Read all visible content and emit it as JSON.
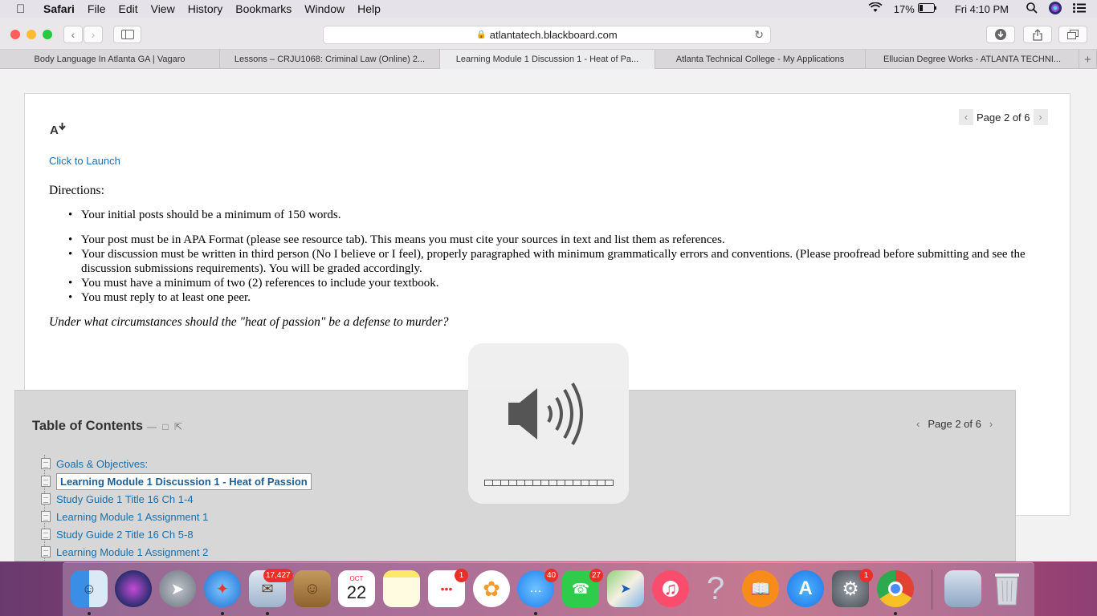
{
  "menubar": {
    "app_name": "Safari",
    "menus": [
      "File",
      "Edit",
      "View",
      "History",
      "Bookmarks",
      "Window",
      "Help"
    ],
    "battery": "17%",
    "clock": "Fri 4:10 PM"
  },
  "toolbar": {
    "url": "atlantatech.blackboard.com"
  },
  "tabs": [
    {
      "title": "Body Language In Atlanta GA | Vagaro",
      "active": false
    },
    {
      "title": "Lessons – CRJU1068: Criminal Law (Online) 2...",
      "active": false
    },
    {
      "title": "Learning Module 1 Discussion 1 - Heat of Pa...",
      "active": true
    },
    {
      "title": "Atlanta Technical College - My Applications",
      "active": false
    },
    {
      "title": "Ellucian Degree Works - ATLANTA TECHNI...",
      "active": false
    }
  ],
  "content": {
    "page_indicator": "Page 2 of 6",
    "text_size_icon": "A",
    "launch_link": "Click to Launch",
    "directions_heading": "Directions:",
    "directions": [
      "Your initial posts should be a minimum of 150 words.",
      "Your post must be in APA Format (please see resource tab).  This means you must cite your sources in text and list them as references.",
      "Your discussion must be written in third person (No I believe or I feel), properly paragraphed with minimum grammatically errors and conventions. (Please proofread before submitting and see the discussion submissions requirements).  You will be graded accordingly.",
      "You must have a minimum of two (2) references to include your textbook.",
      "You must reply to at least one peer."
    ],
    "question": "Under what circumstances should the \"heat of passion\" be a defense to murder?"
  },
  "toc": {
    "title": "Table of Contents",
    "page_indicator": "Page 2 of 6",
    "items": [
      {
        "label": "Goals & Objectives:",
        "current": false
      },
      {
        "label": "Learning Module 1 Discussion 1 - Heat of Passion",
        "current": true
      },
      {
        "label": "Study Guide 1 Title 16 Ch 1-4",
        "current": false
      },
      {
        "label": "Learning Module 1 Assignment 1",
        "current": false
      },
      {
        "label": "Study Guide 2 Title 16 Ch 5-8",
        "current": false
      },
      {
        "label": "Learning Module 1 Assignment 2",
        "current": false
      }
    ]
  },
  "volume_hud": {
    "level": 0,
    "segments": 16
  },
  "dock": {
    "badges": {
      "mail": "17,427",
      "reminders": "1",
      "messages": "40",
      "facetime": "27",
      "system_preferences": "1"
    },
    "calendar_month": "OCT",
    "calendar_day": "22",
    "help_glyph": "?"
  },
  "colors": {
    "link": "#1e6fa8",
    "toc_background": "#d7d7d7",
    "badge": "#e8302b"
  }
}
